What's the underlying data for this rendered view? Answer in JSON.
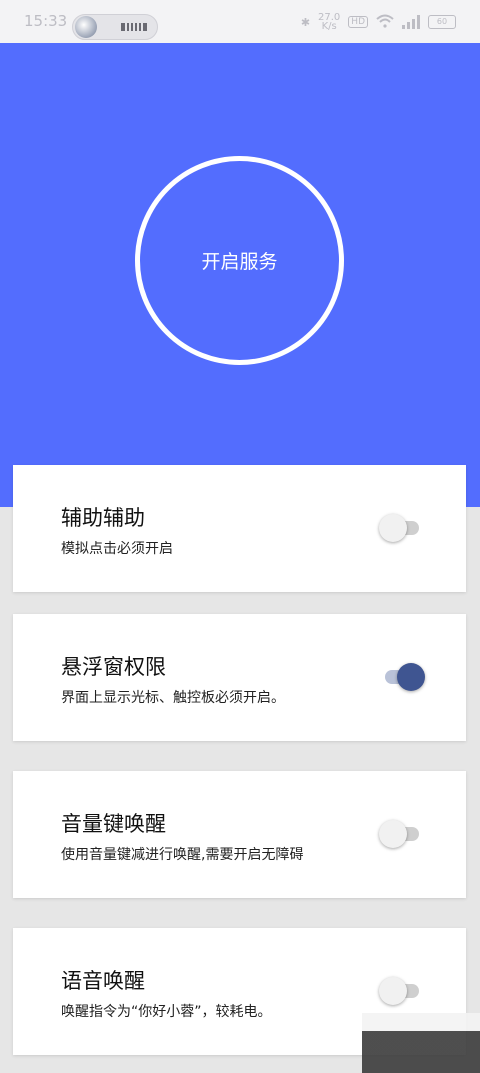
{
  "status_bar": {
    "time": "15:33",
    "net_speed_value": "27.0",
    "net_speed_unit": "K/s",
    "hd_label": "HD",
    "battery": "60"
  },
  "hero": {
    "start_service_label": "开启服务"
  },
  "cards": [
    {
      "title": "辅助辅助",
      "desc": "模拟点击必须开启",
      "enabled": false
    },
    {
      "title": "悬浮窗权限",
      "desc": "界面上显示光标、触控板必须开启。",
      "enabled": true
    },
    {
      "title": "音量键唤醒",
      "desc": "使用音量键减进行唤醒,需要开启无障碍",
      "enabled": false
    },
    {
      "title": "语音唤醒",
      "desc": "唤醒指令为“你好小蓉”，较耗电。",
      "enabled": false
    }
  ],
  "colors": {
    "accent": "#536dfe",
    "switch_on_thumb": "#3f5591",
    "switch_off_thumb": "#f1f1f1"
  }
}
